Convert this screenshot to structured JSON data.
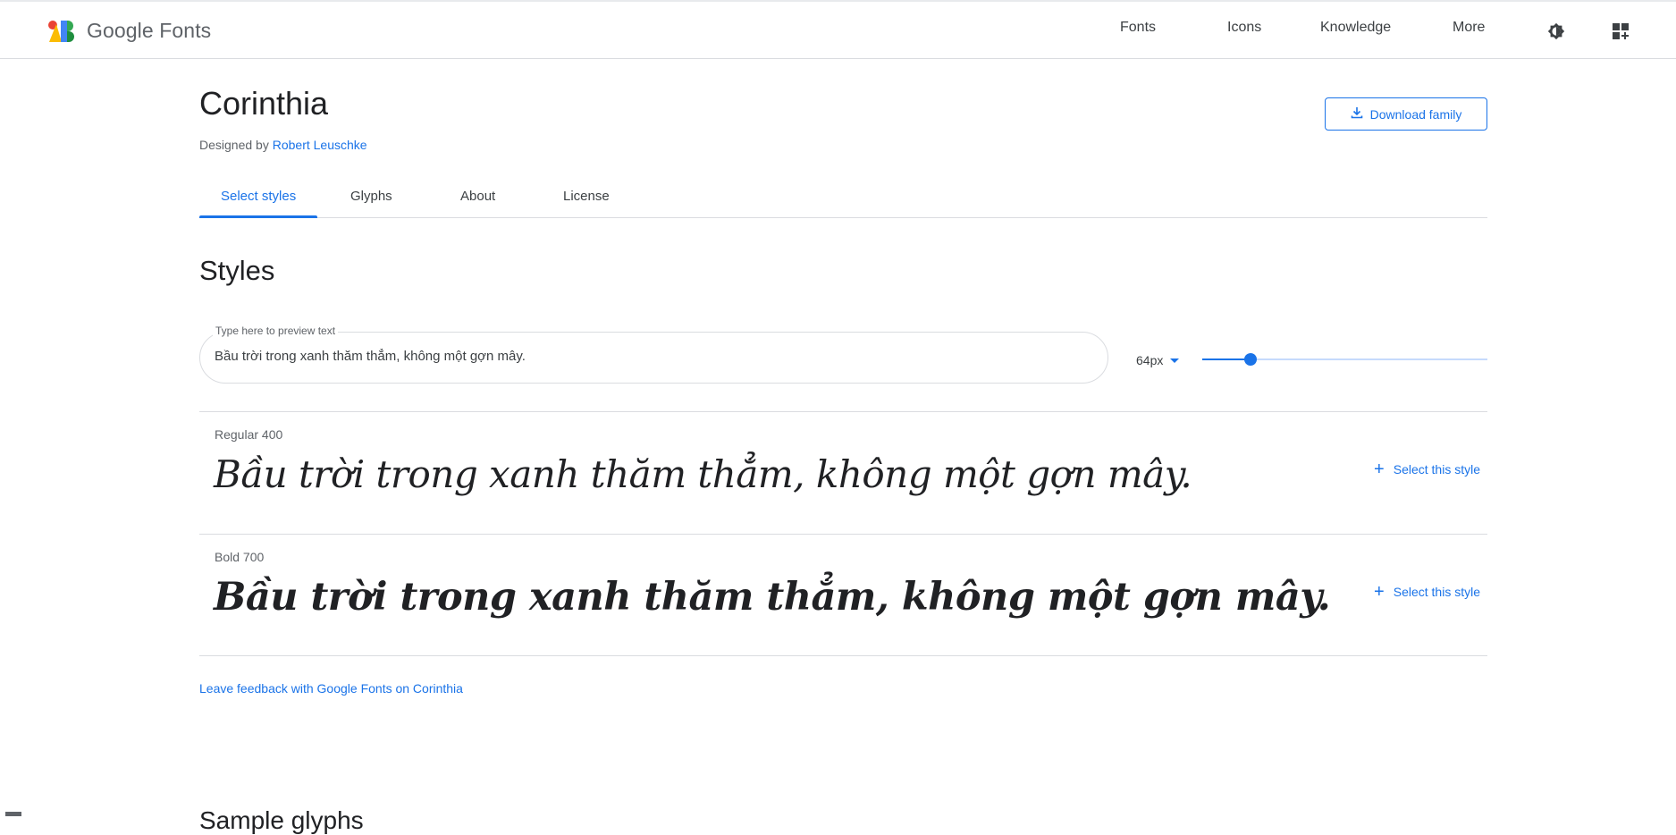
{
  "header": {
    "logo_text": "Google Fonts",
    "nav": [
      {
        "label": "Fonts"
      },
      {
        "label": "Icons"
      },
      {
        "label": "Knowledge"
      },
      {
        "label": "More"
      }
    ],
    "icons": [
      "theme-icon",
      "apps-icon"
    ]
  },
  "family": {
    "name": "Corinthia",
    "designed_by_prefix": "Designed by",
    "designer": "Robert Leuschke",
    "download_label": "Download family"
  },
  "tabs": [
    {
      "label": "Select styles",
      "active": true
    },
    {
      "label": "Glyphs",
      "active": false
    },
    {
      "label": "About",
      "active": false
    },
    {
      "label": "License",
      "active": false
    }
  ],
  "styles_section": {
    "title": "Styles",
    "preview_label": "Type here to preview text",
    "preview_value": "Bầu trời trong xanh thăm thẳm, không một gợn mây.",
    "size_value": "64px",
    "slider_fraction": 0.17
  },
  "styles": [
    {
      "name": "Regular 400",
      "sample": "Bầu trời trong xanh thăm thẳm, không một gợn mây.",
      "action": "Select this style"
    },
    {
      "name": "Bold 700",
      "sample": "Bầu trời trong xanh thăm thẳm, không một gợn mây.",
      "action": "Select this style"
    }
  ],
  "feedback_link": "Leave feedback with Google Fonts on Corinthia",
  "next_section_partial": "Sample glyphs",
  "colors": {
    "accent": "#1a73e8",
    "text": "#202124",
    "muted": "#5f6368",
    "divider": "#dadce0"
  }
}
